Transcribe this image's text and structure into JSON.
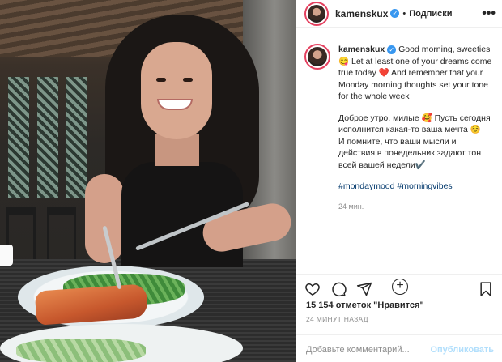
{
  "post": {
    "username": "kamenskux",
    "follow_label": "Подписки",
    "separator": "•",
    "more_glyph": "•••",
    "verified_glyph": "✓"
  },
  "caption": {
    "username": "kamenskux",
    "text_en": "Good morning, sweeties 😋 Let at least one of your dreams come true today ❤️ And remember that your Monday morning thoughts set your tone for the whole week",
    "text_ru": "Доброе утро, милые 🥰 Пусть сегодня исполнится какая-то ваша мечта ☺️\nИ помните, что ваши мысли и действия в понедельник задают тон всей вашей недели✔️",
    "hashtags": [
      "#mondaymood",
      "#morningvibes"
    ],
    "time": "24 мин."
  },
  "load_more_glyph": "+",
  "actions": {
    "likes": "15 154 отметок \"Нравится\"",
    "ago": "24 МИНУТ НАЗАД",
    "icons": [
      "heart-icon",
      "comment-icon",
      "share-icon",
      "bookmark-icon"
    ]
  },
  "comment": {
    "placeholder": "Добавьте комментарий...",
    "publish_label": "Опубликовать"
  },
  "colors": {
    "link": "#00376b",
    "verified": "#3897f0",
    "publish_disabled": "#b2dffc",
    "story_ring": "#e4405f"
  }
}
